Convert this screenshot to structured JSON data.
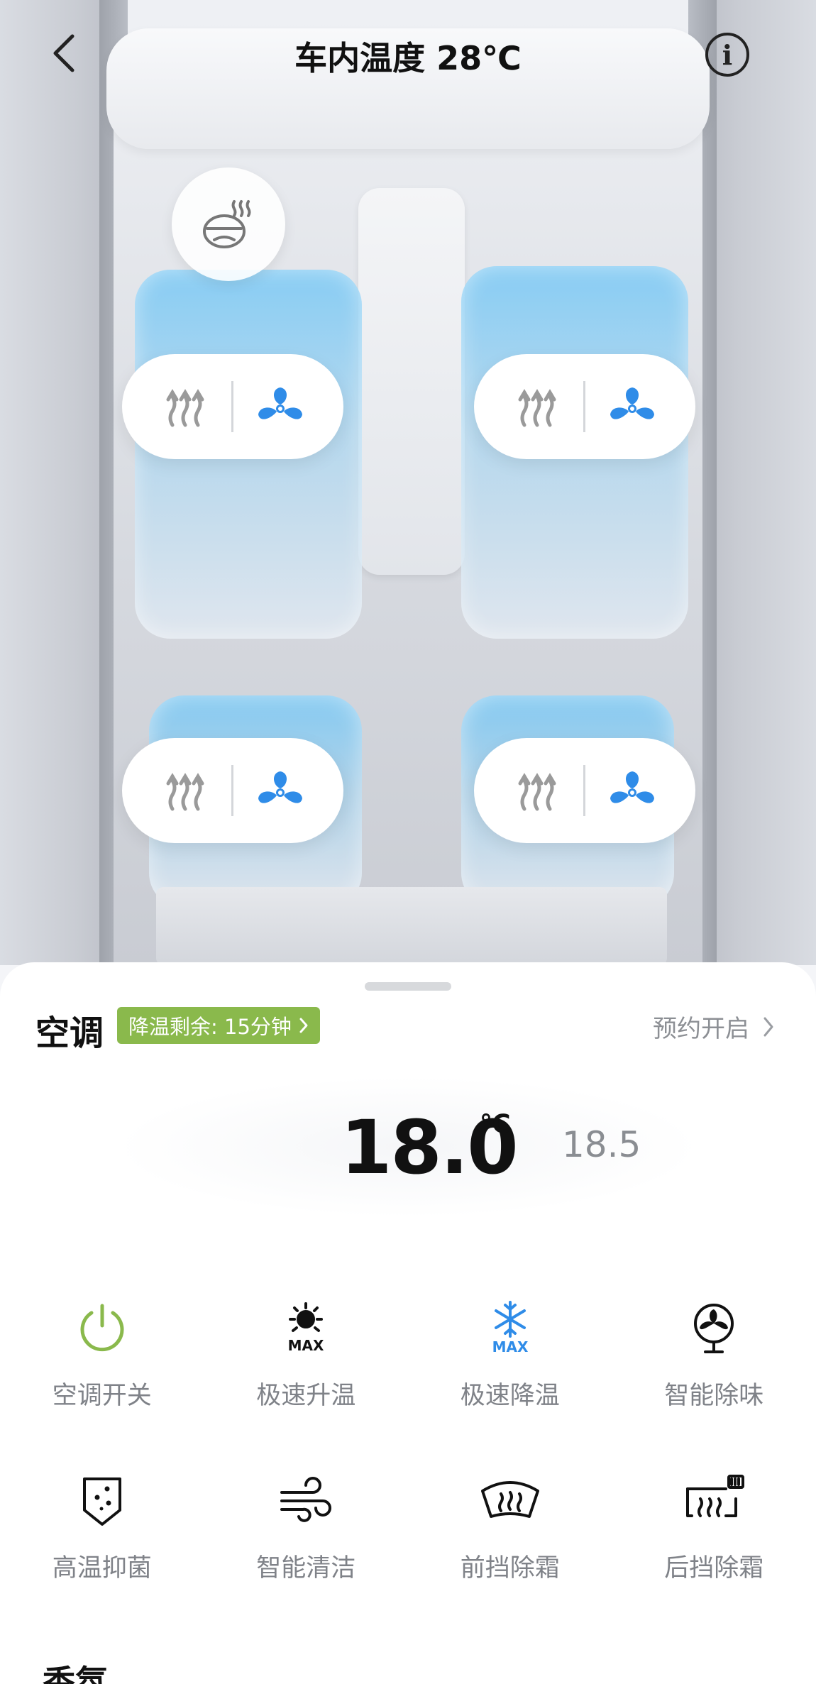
{
  "header": {
    "title": "车内温度 28℃"
  },
  "seats": [
    {
      "position": "front-left",
      "heat_icon": "seat-heat-icon",
      "fan_icon": "seat-fan-icon"
    },
    {
      "position": "front-right",
      "heat_icon": "seat-heat-icon",
      "fan_icon": "seat-fan-icon"
    },
    {
      "position": "rear-left",
      "heat_icon": "seat-heat-icon",
      "fan_icon": "seat-fan-icon"
    },
    {
      "position": "rear-right",
      "heat_icon": "seat-heat-icon",
      "fan_icon": "seat-fan-icon"
    }
  ],
  "ac": {
    "title": "空调",
    "badge": "降温剩余: 15分钟",
    "schedule": "预约开启",
    "temperature": "18.0",
    "unit": "℃",
    "temperature_next": "18.5"
  },
  "controls": [
    {
      "label": "空调开关",
      "icon": "power-icon",
      "color": "#8ab94c"
    },
    {
      "label": "极速升温",
      "icon": "sun-max-icon",
      "color": "#111111"
    },
    {
      "label": "极速降温",
      "icon": "snowflake-max-icon",
      "color": "#2f8ce8"
    },
    {
      "label": "智能除味",
      "icon": "fan-circle-icon",
      "color": "#111111"
    },
    {
      "label": "高温抑菌",
      "icon": "shield-dots-icon",
      "color": "#111111"
    },
    {
      "label": "智能清洁",
      "icon": "wind-icon",
      "color": "#111111"
    },
    {
      "label": "前挡除霜",
      "icon": "front-defrost-icon",
      "color": "#111111"
    },
    {
      "label": "后挡除霜",
      "icon": "rear-defrost-icon",
      "color": "#111111"
    }
  ],
  "next_section": {
    "title": "香氛"
  },
  "colors": {
    "accent_blue": "#2f8ce8",
    "accent_green": "#8ab94c"
  }
}
